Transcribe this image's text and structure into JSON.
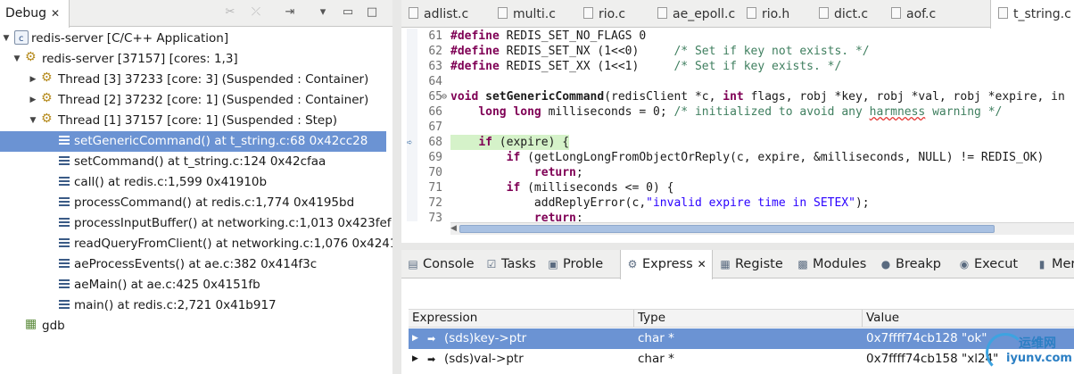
{
  "debug": {
    "tab_label": "Debug",
    "tree": [
      {
        "label": "redis-server [C/C++ Application]",
        "icon": "project-icon",
        "toggle": "▼"
      },
      {
        "label": "redis-server [37157] [cores: 1,3]",
        "icon": "process-icon",
        "toggle": "▼"
      },
      {
        "label": "Thread [3] 37233 [core: 3] (Suspended : Container)",
        "icon": "thread-icon",
        "toggle": "▶"
      },
      {
        "label": "Thread [2] 37232 [core: 1] (Suspended : Container)",
        "icon": "thread-icon",
        "toggle": "▶"
      },
      {
        "label": "Thread [1] 37157 [core: 1] (Suspended : Step)",
        "icon": "thread-icon",
        "toggle": "▼"
      },
      {
        "label": "setGenericCommand() at t_string.c:68 0x42cc28",
        "icon": "stack-frame-icon",
        "toggle": ""
      },
      {
        "label": "setCommand() at t_string.c:124 0x42cfaa",
        "icon": "stack-frame-icon",
        "toggle": ""
      },
      {
        "label": "call() at redis.c:1,599 0x41910b",
        "icon": "stack-frame-icon",
        "toggle": ""
      },
      {
        "label": "processCommand() at redis.c:1,774 0x4195bd",
        "icon": "stack-frame-icon",
        "toggle": ""
      },
      {
        "label": "processInputBuffer() at networking.c:1,013 0x423fef",
        "icon": "stack-frame-icon",
        "toggle": ""
      },
      {
        "label": "readQueryFromClient() at networking.c:1,076 0x4241",
        "icon": "stack-frame-icon",
        "toggle": ""
      },
      {
        "label": "aeProcessEvents() at ae.c:382 0x414f3c",
        "icon": "stack-frame-icon",
        "toggle": ""
      },
      {
        "label": "aeMain() at ae.c:425 0x4151fb",
        "icon": "stack-frame-icon",
        "toggle": ""
      },
      {
        "label": "main() at redis.c:2,721 0x41b917",
        "icon": "stack-frame-icon",
        "toggle": ""
      },
      {
        "label": "gdb",
        "icon": "gdb-icon",
        "toggle": ""
      }
    ]
  },
  "editor": {
    "tabs": [
      "adlist.c",
      "multi.c",
      "rio.c",
      "ae_epoll.c",
      "rio.h",
      "dict.c",
      "aof.c",
      "t_string.c"
    ],
    "active_tab": "t_string.c",
    "lines": [
      {
        "n": "61",
        "text": "#define REDIS_SET_NO_FLAGS 0"
      },
      {
        "n": "62",
        "text": "#define REDIS_SET_NX (1<<0)     /* Set if key not exists. */"
      },
      {
        "n": "63",
        "text": "#define REDIS_SET_XX (1<<1)     /* Set if key exists. */"
      },
      {
        "n": "64",
        "text": ""
      },
      {
        "n": "65",
        "text": "void setGenericCommand(redisClient *c, int flags, robj *key, robj *val, robj *expire, in"
      },
      {
        "n": "66",
        "text": "    long long milliseconds = 0; /* initialized to avoid any harmness warning */"
      },
      {
        "n": "67",
        "text": ""
      },
      {
        "n": "68",
        "text": "    if (expire) {"
      },
      {
        "n": "69",
        "text": "        if (getLongLongFromObjectOrReply(c, expire, &milliseconds, NULL) != REDIS_OK)"
      },
      {
        "n": "70",
        "text": "            return;"
      },
      {
        "n": "71",
        "text": "        if (milliseconds <= 0) {"
      },
      {
        "n": "72",
        "text": "            addReplyError(c,\"invalid expire time in SETEX\");"
      },
      {
        "n": "73",
        "text": "            return;"
      }
    ]
  },
  "bottom": {
    "tabs": [
      {
        "label": "Console",
        "icon": "console-icon",
        "glyph": "▤"
      },
      {
        "label": "Tasks",
        "icon": "tasks-icon",
        "glyph": "☑"
      },
      {
        "label": "Proble",
        "icon": "problems-icon",
        "glyph": "▣"
      },
      {
        "label": "Express",
        "icon": "expressions-icon",
        "glyph": "⚙"
      },
      {
        "label": "Registe",
        "icon": "registers-icon",
        "glyph": "▦"
      },
      {
        "label": "Modules",
        "icon": "modules-icon",
        "glyph": "▩"
      },
      {
        "label": "Breakp",
        "icon": "breakpoints-icon",
        "glyph": "●"
      },
      {
        "label": "Execut",
        "icon": "executables-icon",
        "glyph": "◉"
      },
      {
        "label": "Mer",
        "icon": "memory-icon",
        "glyph": "▮"
      }
    ],
    "active_tab": "Express",
    "columns": [
      "Expression",
      "Type",
      "Value"
    ],
    "rows": [
      {
        "expr": "(sds)key->ptr",
        "type": "char *",
        "value": "0x7ffff74cb128 \"ok\""
      },
      {
        "expr": "(sds)val->ptr",
        "type": "char *",
        "value": "0x7ffff74cb158 \"xl24\""
      }
    ]
  },
  "watermark": {
    "cn": "运维网",
    "url": "iyunv.com"
  }
}
